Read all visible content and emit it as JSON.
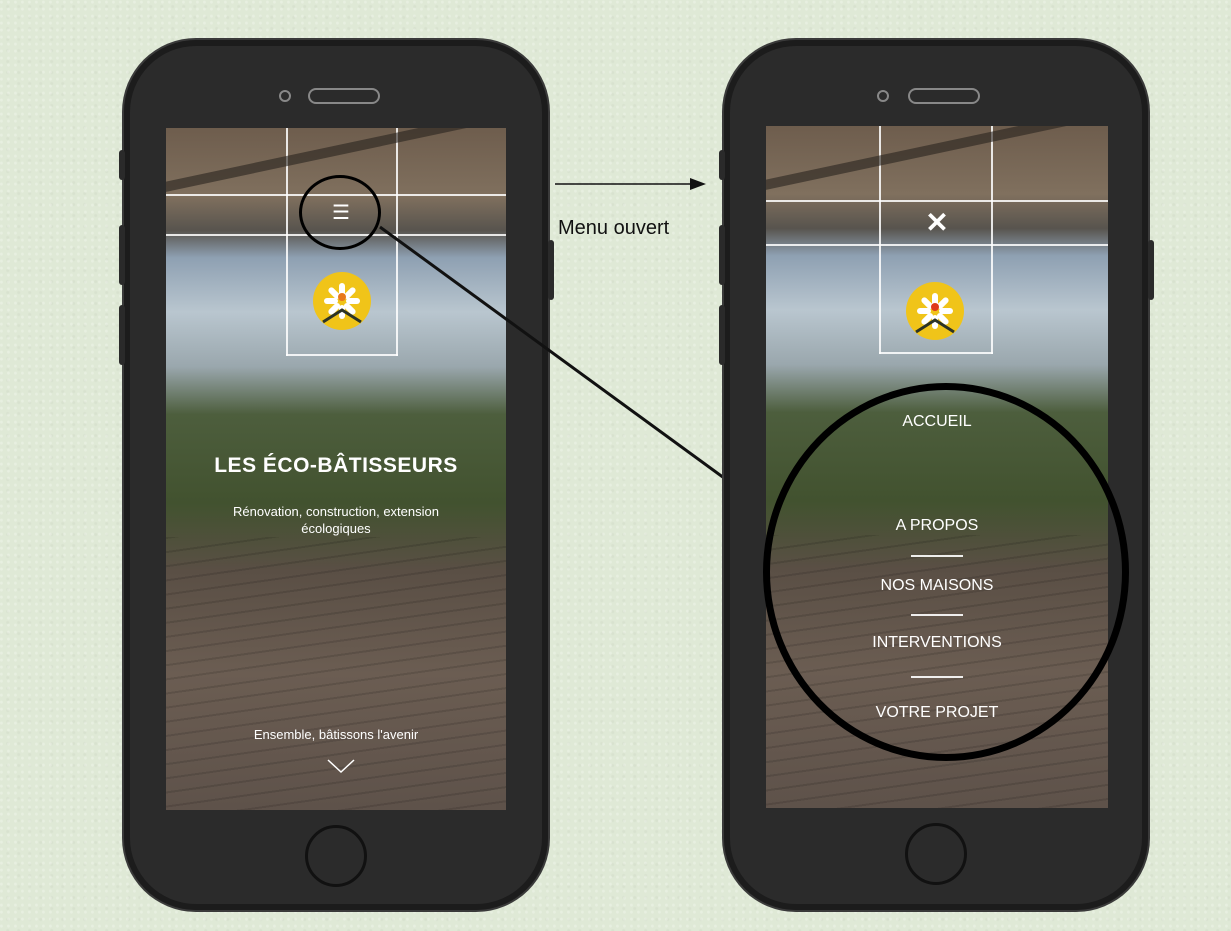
{
  "annotation": {
    "label": "Menu ouvert"
  },
  "left_screen": {
    "menu_icon": "☰",
    "title": "LES ÉCO-BÂTISSEURS",
    "subtitle_line1": "Rénovation, construction, extension",
    "subtitle_line2": "écologiques",
    "tagline": "Ensemble, bâtissons l'avenir",
    "scroll_icon": "chevron-down-icon"
  },
  "right_screen": {
    "close_icon": "✕",
    "menu_items": [
      "ACCUEIL",
      "A PROPOS",
      "NOS MAISONS",
      "INTERVENTIONS",
      "VOTRE PROJET"
    ]
  },
  "colors": {
    "logo_yellow": "#f0c419",
    "logo_core": "#e8781a",
    "background": "#dfe9d6"
  }
}
